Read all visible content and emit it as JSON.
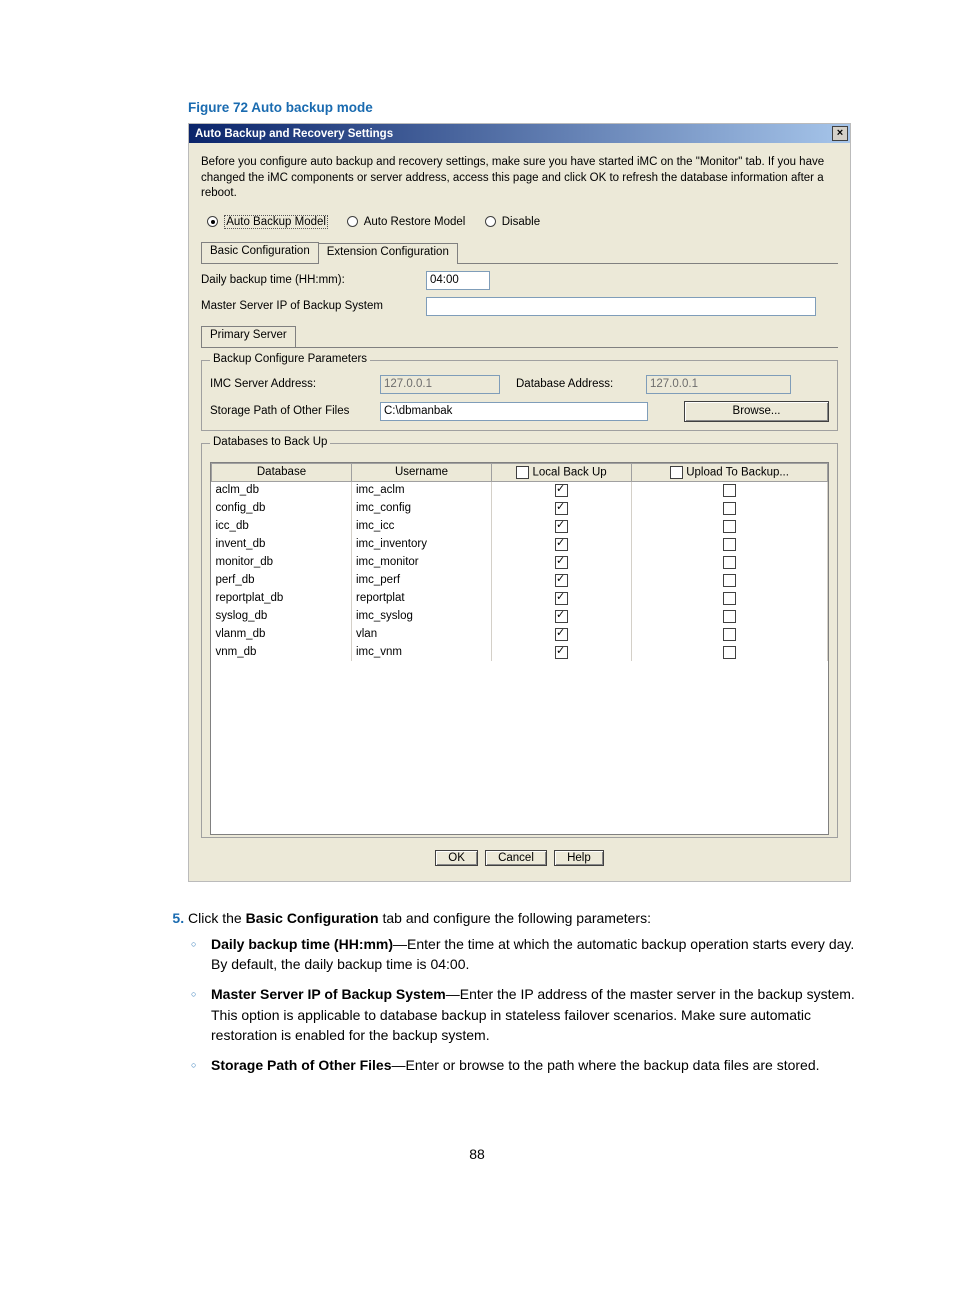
{
  "figure_caption": "Figure 72 Auto backup mode",
  "dialog": {
    "title": "Auto Backup and Recovery Settings",
    "intro": "Before you configure auto backup and recovery settings, make sure you have started iMC on the \"Monitor\" tab. If you have changed the iMC components or server address, access this page and click OK to refresh the database information after a reboot.",
    "radios": {
      "auto_backup": "Auto Backup Model",
      "auto_restore": "Auto Restore Model",
      "disable": "Disable"
    },
    "tabs": {
      "basic": "Basic Configuration",
      "extension": "Extension Configuration"
    },
    "fields": {
      "daily_time_label": "Daily backup time (HH:mm):",
      "daily_time_value": "04:00",
      "master_ip_label": "Master Server IP of Backup System",
      "master_ip_value": ""
    },
    "subtab_primary": "Primary Server",
    "group_params": {
      "legend": "Backup Configure Parameters",
      "imc_addr_label": "IMC Server Address:",
      "imc_addr_value": "127.0.0.1",
      "db_addr_label": "Database Address:",
      "db_addr_value": "127.0.0.1",
      "storage_label": "Storage Path of Other Files",
      "storage_value": "C:\\dbmanbak",
      "browse": "Browse..."
    },
    "group_dbs": {
      "legend": "Databases to Back Up",
      "headers": {
        "database": "Database",
        "username": "Username",
        "local": "Local Back Up",
        "upload": "Upload To Backup..."
      },
      "rows": [
        {
          "db": "aclm_db",
          "user": "imc_aclm",
          "local": true,
          "upload": false
        },
        {
          "db": "config_db",
          "user": "imc_config",
          "local": true,
          "upload": false
        },
        {
          "db": "icc_db",
          "user": "imc_icc",
          "local": true,
          "upload": false
        },
        {
          "db": "invent_db",
          "user": "imc_inventory",
          "local": true,
          "upload": false
        },
        {
          "db": "monitor_db",
          "user": "imc_monitor",
          "local": true,
          "upload": false
        },
        {
          "db": "perf_db",
          "user": "imc_perf",
          "local": true,
          "upload": false
        },
        {
          "db": "reportplat_db",
          "user": "reportplat",
          "local": true,
          "upload": false
        },
        {
          "db": "syslog_db",
          "user": "imc_syslog",
          "local": true,
          "upload": false
        },
        {
          "db": "vlanm_db",
          "user": "vlan",
          "local": true,
          "upload": false
        },
        {
          "db": "vnm_db",
          "user": "imc_vnm",
          "local": true,
          "upload": false
        }
      ]
    },
    "buttons": {
      "ok": "OK",
      "cancel": "Cancel",
      "help": "Help"
    }
  },
  "step5": {
    "num": "5.",
    "lead1": "Click the ",
    "bold1": "Basic Configuration",
    "lead2": " tab and configure the following parameters:",
    "items": [
      {
        "bold": "Daily backup time (HH:mm)",
        "rest": "—Enter the time at which the automatic backup operation starts every day. By default, the daily backup time is 04:00."
      },
      {
        "bold": "Master Server IP of Backup System",
        "rest": "—Enter the IP address of the master server in the backup system. This option is applicable to database backup in stateless failover scenarios. Make sure automatic restoration is enabled for the backup system."
      },
      {
        "bold": "Storage Path of Other Files",
        "rest": "—Enter or browse to the path where the backup data files are stored."
      }
    ]
  },
  "page_number": "88"
}
